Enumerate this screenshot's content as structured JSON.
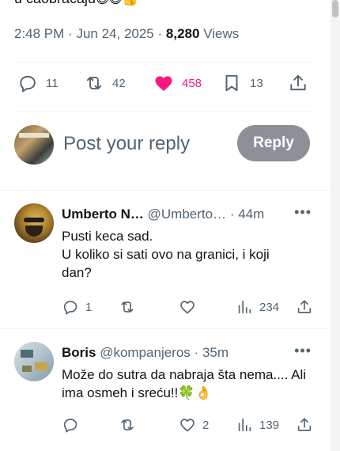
{
  "original_post": {
    "text_tail": "u caobraćaju",
    "text_tail_emoji": "😅😅👍",
    "time": "2:48 PM",
    "date": "Jun 24, 2025",
    "separator": "·",
    "views_count": "8,280",
    "views_label": "Views",
    "actions": {
      "replies": "11",
      "reposts": "42",
      "likes": "458",
      "bookmarks": "13"
    }
  },
  "reply_composer": {
    "placeholder": "Post your reply",
    "button_label": "Reply"
  },
  "replies": [
    {
      "name": "Umberto N…",
      "handle": "@Umberto…",
      "dot": "·",
      "time": "44m",
      "text": "Pusti keca sad.\nU koliko si sati ovo na granici, i koji dan?",
      "actions": {
        "replies": "1",
        "reposts": "",
        "likes": "",
        "views": "234"
      }
    },
    {
      "name": "Boris",
      "handle": "@kompanjeros",
      "dot": "·",
      "time": "35m",
      "text": "Može do sutra da nabraja šta nema.... Ali ima osmeh i sreću!!🍀👌",
      "actions": {
        "replies": "",
        "reposts": "",
        "likes": "2",
        "views": "139"
      }
    }
  ],
  "colors": {
    "text_primary": "#0f1419",
    "text_secondary": "#536471",
    "like_active": "#f91880",
    "reply_button_bg": "#8b9196",
    "divider": "#eff3f4"
  },
  "icons": {
    "reply": "reply-icon",
    "repost": "repost-icon",
    "like": "heart-icon",
    "bookmark": "bookmark-icon",
    "share": "share-icon",
    "views": "views-icon",
    "more": "more-icon"
  }
}
